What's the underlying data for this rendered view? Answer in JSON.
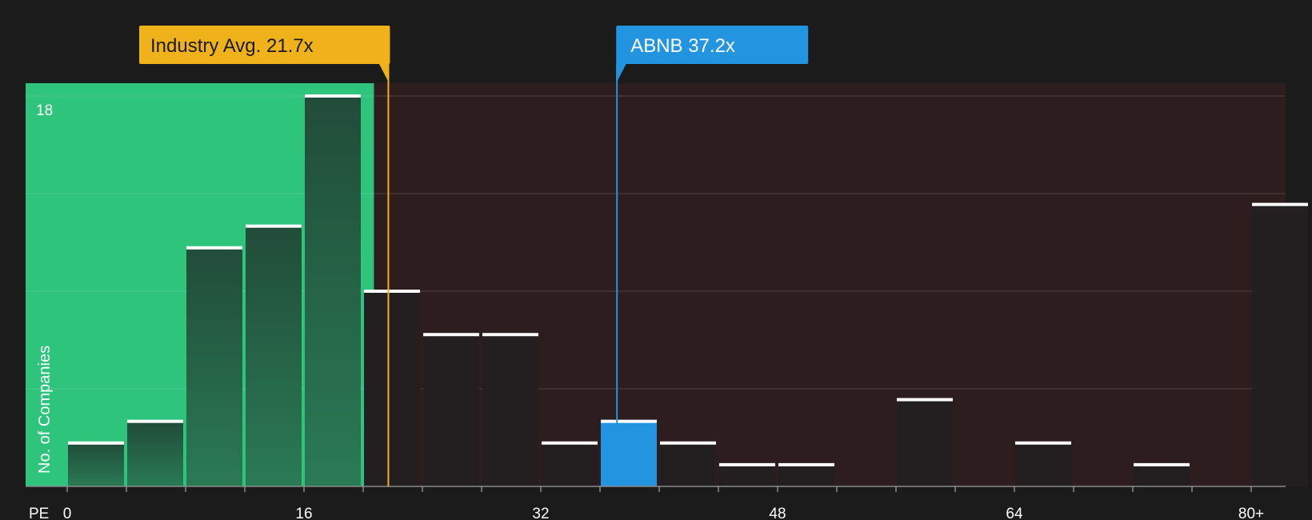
{
  "chart_data": {
    "type": "bar",
    "x_axis_label": "PE",
    "y_axis_label": "No. of Companies",
    "y_max_label": "18",
    "x_ticks": [
      "0",
      "16",
      "32",
      "48",
      "64",
      "80+"
    ],
    "bin_edges": [
      0,
      4,
      8,
      12,
      16,
      20,
      24,
      28,
      32,
      36,
      40,
      44,
      48,
      52,
      56,
      60,
      64,
      68,
      72,
      76,
      80,
      84
    ],
    "values": [
      2,
      3,
      11,
      12,
      18,
      9,
      7,
      7,
      2,
      3,
      2,
      1,
      1,
      0,
      4,
      0,
      2,
      0,
      1,
      0,
      13
    ],
    "ylim": [
      0,
      18
    ],
    "highlight_bin": 9,
    "industry_avg": {
      "label": "Industry Avg. 21.7x",
      "value": 21.7
    },
    "company": {
      "label": "ABNB 37.2x",
      "value": 37.2
    },
    "colors": {
      "background": "#1b1b1b",
      "fair_zone": "#2ec47c",
      "expensive_zone": "#2e1d1f",
      "bar_fair": "#214c39",
      "bar_expensive": "#231f20",
      "bar_highlight": "#2394e0",
      "industry_avg": "#f0b21a",
      "company": "#2394e0",
      "bar_top": "#ffffff"
    }
  }
}
